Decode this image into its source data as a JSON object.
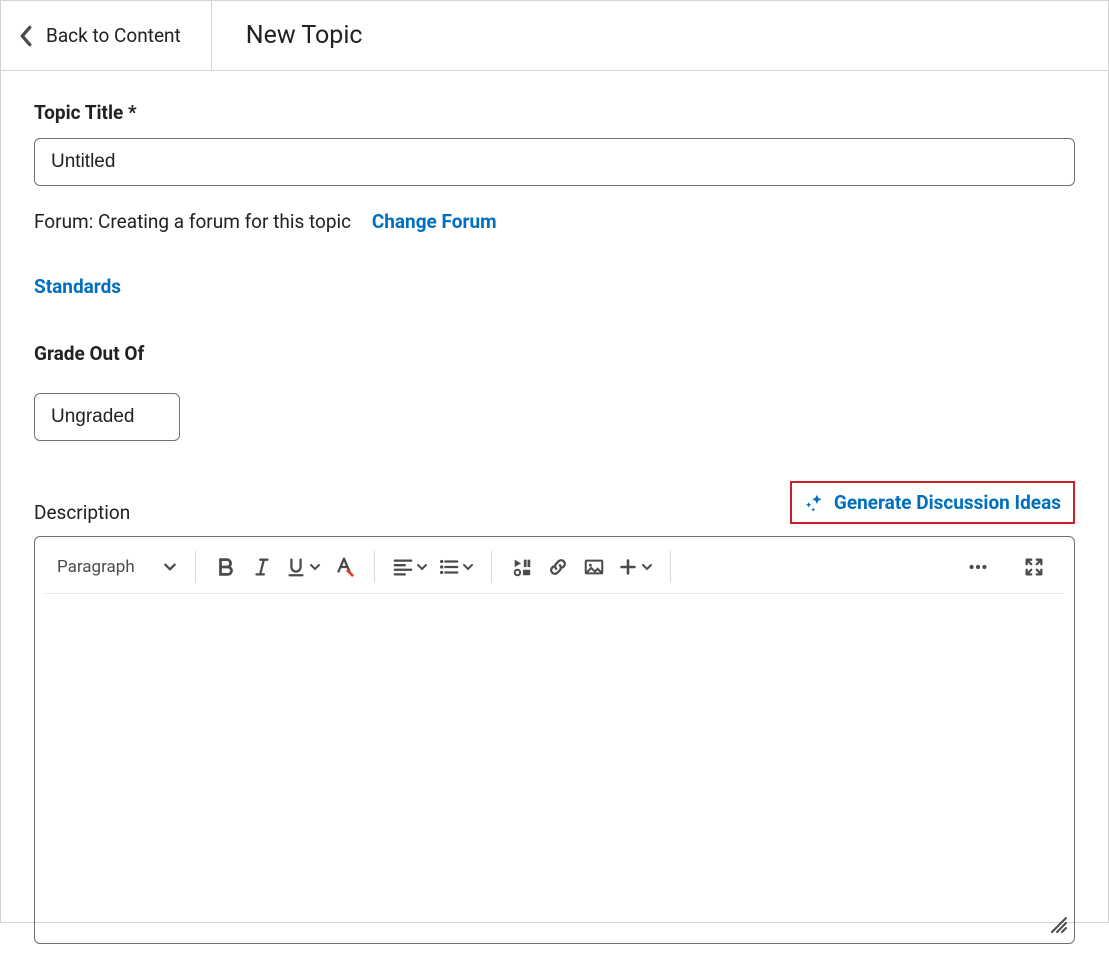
{
  "header": {
    "back_label": "Back to Content",
    "title": "New Topic"
  },
  "form": {
    "title_label": "Topic Title *",
    "title_value": "Untitled",
    "forum_prefix": "Forum: ",
    "forum_text": "Creating a forum for this topic",
    "change_forum": "Change Forum",
    "standards": "Standards",
    "grade_label": "Grade Out Of",
    "grade_value": "Ungraded",
    "description_label": "Description",
    "generate_label": "Generate Discussion Ideas"
  },
  "toolbar": {
    "paragraph": "Paragraph"
  }
}
